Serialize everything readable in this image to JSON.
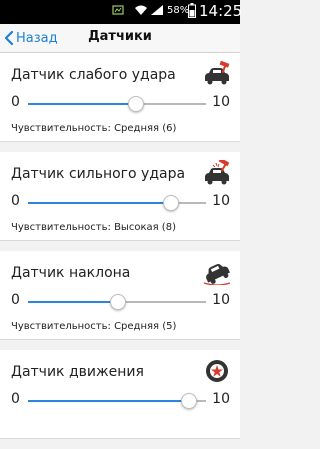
{
  "statusbar": {
    "battery_percent": "58%",
    "time": "14:25"
  },
  "navbar": {
    "back_label": "Назад",
    "title": "Датчики"
  },
  "sensors": [
    {
      "title": "Датчик слабого удара",
      "icon": "car-hammer-icon",
      "min": "0",
      "max": "10",
      "value": 6,
      "sensitivity": "Чувствительность: Средняя (6)"
    },
    {
      "title": "Датчик сильного удара",
      "icon": "car-hammer-strong-icon",
      "min": "0",
      "max": "10",
      "value": 8,
      "sensitivity": "Чувствительность: Высокая (8)"
    },
    {
      "title": "Датчик наклона",
      "icon": "car-tilt-icon",
      "min": "0",
      "max": "10",
      "value": 5,
      "sensitivity": "Чувствительность: Средняя (5)"
    },
    {
      "title": "Датчик движения",
      "icon": "wheel-icon",
      "min": "0",
      "max": "10",
      "value": 9,
      "sensitivity": ""
    }
  ],
  "colors": {
    "accent": "#1e7fd8",
    "hammer": "#d93a2b"
  }
}
